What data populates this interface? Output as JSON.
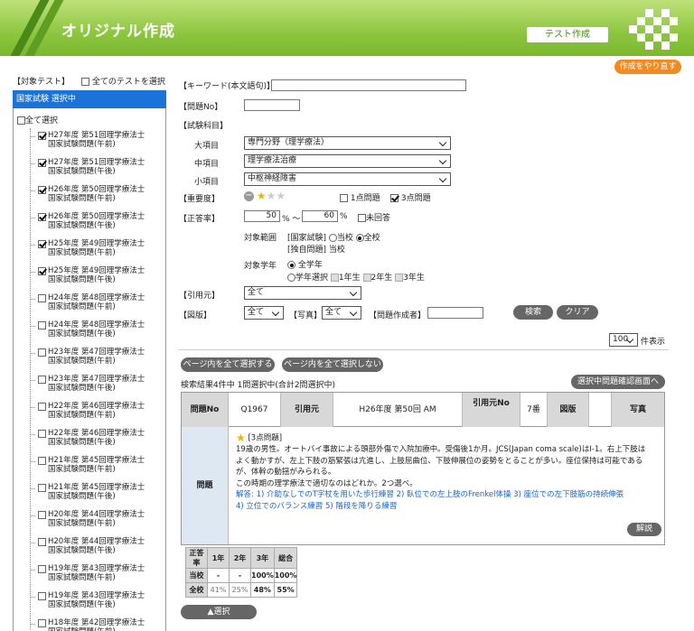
{
  "header": {
    "title": "オリジナル作成",
    "test_button": "テスト作成",
    "redo_button": "作成をやり直す"
  },
  "sidebar": {
    "target_label": "【対象テスト】",
    "select_all_tests": "全てのテストを選択",
    "selected": "国家試験 選択中",
    "select_all": "全て選択",
    "items": [
      {
        "line1": "H27年度 第51回理学療法士",
        "line2": "国家試験問題(午前)",
        "checked": true
      },
      {
        "line1": "H27年度 第51回理学療法士",
        "line2": "国家試験問題(午後)",
        "checked": true
      },
      {
        "line1": "H26年度 第50回理学療法士",
        "line2": "国家試験問題(午前)",
        "checked": true
      },
      {
        "line1": "H26年度 第50回理学療法士",
        "line2": "国家試験問題(午後)",
        "checked": true
      },
      {
        "line1": "H25年度 第49回理学療法士",
        "line2": "国家試験問題(午前)",
        "checked": true
      },
      {
        "line1": "H25年度 第49回理学療法士",
        "line2": "国家試験問題(午後)",
        "checked": true
      },
      {
        "line1": "H24年度 第48回理学療法士",
        "line2": "国家試験問題(午前)",
        "checked": false
      },
      {
        "line1": "H24年度 第48回理学療法士",
        "line2": "国家試験問題(午後)",
        "checked": false
      },
      {
        "line1": "H23年度 第47回理学療法士",
        "line2": "国家試験問題(午前)",
        "checked": false
      },
      {
        "line1": "H23年度 第47回理学療法士",
        "line2": "国家試験問題(午後)",
        "checked": false
      },
      {
        "line1": "H22年度 第46回理学療法士",
        "line2": "国家試験問題(午前)",
        "checked": false
      },
      {
        "line1": "H22年度 第46回理学療法士",
        "line2": "国家試験問題(午後)",
        "checked": false
      },
      {
        "line1": "H21年度 第45回理学療法士",
        "line2": "国家試験問題(午前)",
        "checked": false
      },
      {
        "line1": "H21年度 第45回理学療法士",
        "line2": "国家試験問題(午後)",
        "checked": false
      },
      {
        "line1": "H20年度 第44回理学療法士",
        "line2": "国家試験問題(午前)",
        "checked": false
      },
      {
        "line1": "H20年度 第44回理学療法士",
        "line2": "国家試験問題(午後)",
        "checked": false
      },
      {
        "line1": "H19年度 第43回理学療法士",
        "line2": "国家試験問題(午前)",
        "checked": false
      },
      {
        "line1": "H19年度 第43回理学療法士",
        "line2": "国家試験問題(午後)",
        "checked": false
      },
      {
        "line1": "H18年度 第42回理学療法士",
        "line2": "国家試験問題(午前)",
        "checked": false
      }
    ]
  },
  "form": {
    "keyword_label": "【キーワード(本文語句)】",
    "keyword_value": "",
    "qno_label": "【問題No】",
    "qno_value": "",
    "subject_label": "【試験科目】",
    "major_label": "大項目",
    "major_value": "専門分野（理学療法）",
    "middle_label": "中項目",
    "middle_value": "理学療法治療",
    "minor_label": "小項目",
    "minor_value": "中枢神経障害",
    "importance_label": "【重要度】",
    "importance_stars": 1,
    "one_point_label": "1点問題",
    "three_point_label": "3点問題",
    "one_point_checked": false,
    "three_point_checked": true,
    "rate_label": "【正答率】",
    "rate_min": "50",
    "rate_sep": "% 〜",
    "rate_max": "60",
    "rate_unit": "%",
    "unanswered_label": "未回答",
    "scope_label": "対象範囲",
    "scope_national": "[国家試験]",
    "scope_school": "当校",
    "scope_all": "全校",
    "scope_original": "[独自問題] 当校",
    "year_label": "対象学年",
    "year_all": "全学年",
    "year_select": "学年選択",
    "year1": "1年生",
    "year2": "2年生",
    "year3": "3年生",
    "citation_label": "【引用元】",
    "citation_value": "全て",
    "figure_label": "【図版】",
    "figure_value": "全て",
    "photo_label": "【写真】",
    "photo_value": "全て",
    "author_label": "【問題作成者】",
    "author_value": "",
    "search_button": "検索",
    "clear_button": "クリア",
    "per_page_value": "100",
    "per_page_label": "件表示"
  },
  "results": {
    "select_all_page": "ページ内を全て選択する",
    "deselect_all_page": "ページ内を全て選択しない",
    "summary": "検索結果4件中 1問選択中(合計2問選択中)",
    "confirm_button": "選択中問題確認画面へ",
    "head": {
      "qno_label": "問題No",
      "qno_value": "Q1967",
      "citation_label": "引用元",
      "citation_value": "H26年度 第50回 AM",
      "citation_no_label": "引用元No",
      "citation_no_value": "7番",
      "figure_label": "図版",
      "figure_value": "",
      "photo_label": "写真"
    },
    "question_label": "問題",
    "stars": 1,
    "point_tag": "[3点問題]",
    "question_lines": [
      "19歳の男性。オートバイ事故による頭部外傷で入院加療中。受傷後1か月。JCS(Japan coma scale)はⅠ-1。右上下肢は",
      "よく動かすが、左上下肢の筋緊張は亢進し、上肢屈曲位、下肢伸展位の姿勢をとることが多い。座位保持は可能である",
      "が、体幹の動揺がみられる。",
      "この時期の理学療法で適切なのはどれか。2つ選べ。"
    ],
    "answer_lines": [
      "解答: 1) 介助なしでのT字杖を用いた歩行練習  2) 臥位での左上肢のFrenkel体操  3) 座位での左下肢筋の持続伸張",
      "4) 立位でのバランス練習  5) 階段を降りる練習"
    ],
    "kaisetsu_button": "解説",
    "stats": {
      "headers": [
        "正答率",
        "1年",
        "2年",
        "3年",
        "総合"
      ],
      "rows": [
        [
          "当校",
          "-",
          "-",
          "100%",
          "100%"
        ],
        [
          "全校",
          "41%",
          "25%",
          "48%",
          "55%"
        ]
      ]
    },
    "select_button": "▲選択"
  },
  "colors": {
    "header_green": "#8cc63f",
    "accent_orange": "#f28a1e",
    "selected_blue": "#1a73d9",
    "answer_blue": "#1a63c8"
  }
}
